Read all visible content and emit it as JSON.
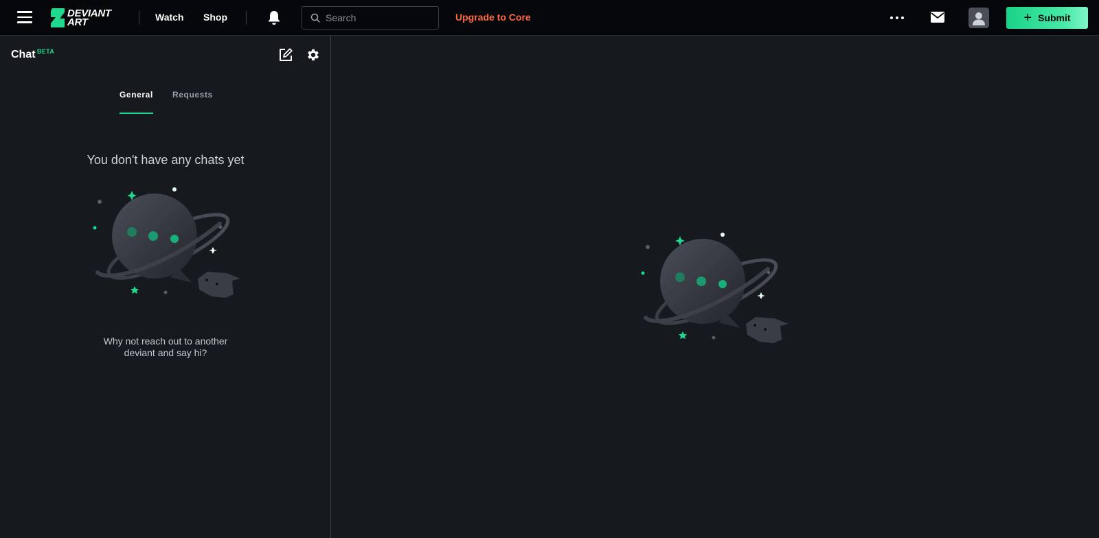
{
  "header": {
    "logo_line1": "DEVIANT",
    "logo_line2": "ART",
    "nav": {
      "watch": "Watch",
      "shop": "Shop"
    },
    "search": {
      "placeholder": "Search",
      "value": ""
    },
    "upgrade_label": "Upgrade to Core",
    "submit_label": "Submit"
  },
  "sidebar": {
    "title": "Chat",
    "badge": "BETA",
    "tabs": [
      {
        "label": "General",
        "active": true
      },
      {
        "label": "Requests",
        "active": false
      }
    ],
    "empty_title": "You don't have any chats yet",
    "empty_subtitle": "Why not reach out to another deviant and say hi?"
  },
  "colors": {
    "accent": "#1ed98f",
    "upgrade": "#ff6b3d",
    "background": "#16191e",
    "header_bg": "#06070a"
  },
  "icons": {
    "menu": "hamburger-icon",
    "bell": "bell-icon",
    "search": "search-icon",
    "more": "more-dots-icon",
    "mail": "mail-icon",
    "avatar": "user-avatar-icon",
    "plus": "plus-icon",
    "edit": "edit-icon",
    "settings": "gear-icon"
  }
}
